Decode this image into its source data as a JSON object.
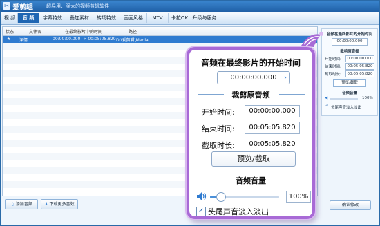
{
  "app": {
    "title": "爱剪辑",
    "slogan": "超易用、强大的视频剪辑软件"
  },
  "tabs": [
    "视 频",
    "音 频",
    "字幕特效",
    "叠加素材",
    "转场特效",
    "画面风格",
    "MTV",
    "卡拉OK",
    "升级与服务"
  ],
  "active_tab_index": 1,
  "table": {
    "columns": [
      "状态",
      "文件名",
      "在最终影片中的时间",
      "路径"
    ],
    "rows": [
      {
        "status": "★",
        "name": "深情",
        "time": "00:00:00.000 -> 00:05:05.820",
        "path": "D:\\爱剪辑\\Media..."
      }
    ]
  },
  "bottom_buttons": {
    "add_audio": "添加音频",
    "download_audio": "下载更多音效"
  },
  "right_panel": {
    "title": "音频在最终影片的开始时间",
    "start_time_value": "00:00:00.000",
    "crop_title": "裁剪原音频",
    "start_label": "开始时间:",
    "end_label": "结束时间:",
    "crop_length_label": "截取时长:",
    "preview_button": "预览/截取",
    "volume_title": "音频音量",
    "volume_value": "100%",
    "fade_label": "头尾声音淡入淡出",
    "confirm_button": "确认修改"
  },
  "zoom": {
    "title": "音频在最终影片的开始时间",
    "start_time_value": "00:00:00.000",
    "crop_title": "裁剪原音频",
    "start_label": "开始时间:",
    "start_value": "00:00:00.000",
    "end_label": "结束时间:",
    "end_value": "00:05:05.820",
    "crop_length_label": "截取时长:",
    "crop_length_value": "00:05:05.820",
    "preview_button": "预览/截取",
    "volume_title": "音频音量",
    "volume_value": "100%",
    "volume_level": 0.15,
    "fade_checked": true,
    "fade_label": "头尾声音淡入淡出"
  },
  "colors": {
    "accent": "#2f7bd0",
    "callout_border": "#a86ad6"
  }
}
